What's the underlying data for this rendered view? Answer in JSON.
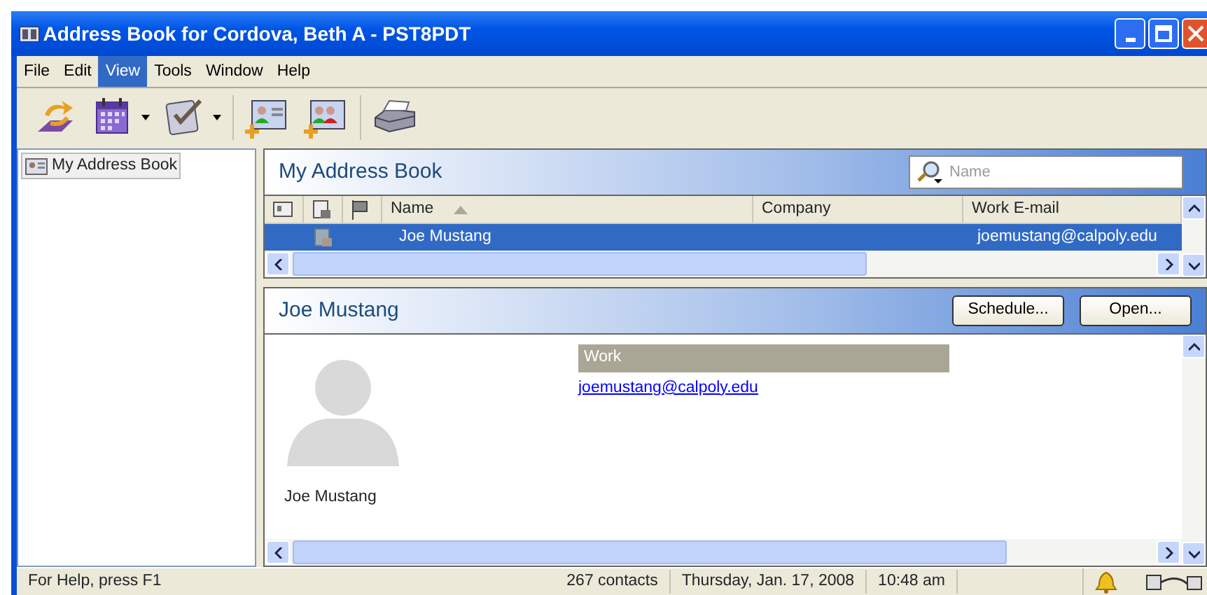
{
  "window": {
    "title": "Address Book for Cordova, Beth A - PST8PDT"
  },
  "menu": [
    {
      "label": "File",
      "selected": false
    },
    {
      "label": "Edit",
      "selected": false
    },
    {
      "label": "View",
      "selected": true
    },
    {
      "label": "Tools",
      "selected": false
    },
    {
      "label": "Window",
      "selected": false
    },
    {
      "label": "Help",
      "selected": false
    }
  ],
  "toolbar": [
    {
      "kind": "sync",
      "dropdown": false
    },
    {
      "kind": "calendar",
      "dropdown": true
    },
    {
      "kind": "task",
      "dropdown": true
    },
    {
      "kind": "new-contact",
      "dropdown": false
    },
    {
      "kind": "new-group",
      "dropdown": false
    },
    {
      "kind": "print",
      "dropdown": false
    }
  ],
  "folders": [
    {
      "label": "My Address Book",
      "selected": true
    }
  ],
  "list_pane": {
    "title": "My Address Book",
    "search": {
      "placeholder": "Name"
    },
    "columns": [
      {
        "label": "Name",
        "sorted": true
      },
      {
        "label": "Company",
        "sorted": false
      },
      {
        "label": "Work E-mail",
        "sorted": false
      }
    ],
    "rows": [
      {
        "name": "Joe Mustang",
        "email": "joemustang@calpoly.edu",
        "selected": true
      }
    ]
  },
  "detail": {
    "title": "Joe Mustang",
    "buttons": [
      "Schedule...",
      "Open..."
    ],
    "section": "Work",
    "email": "joemustang@calpoly.edu",
    "caption": "Joe Mustang"
  },
  "status_bar": {
    "help": "For Help, press F1",
    "count": "267 contacts",
    "date": "Thursday, Jan. 17, 2008",
    "time": "10:48 am"
  }
}
